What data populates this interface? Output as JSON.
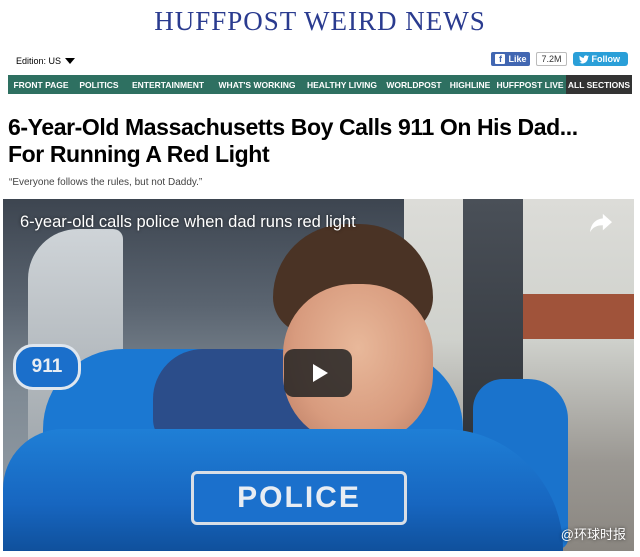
{
  "site": {
    "brand": "HUFFPOST WEIRD NEWS"
  },
  "edition": {
    "label": "Edition: US"
  },
  "social": {
    "facebook_label": "Like",
    "facebook_count": "7.2M",
    "twitter_label": "Follow"
  },
  "nav": {
    "items": [
      {
        "label": "FRONT PAGE"
      },
      {
        "label": "POLITICS"
      },
      {
        "label": "ENTERTAINMENT"
      },
      {
        "label": "WHAT'S WORKING"
      },
      {
        "label": "HEALTHY LIVING"
      },
      {
        "label": "WORLDPOST"
      },
      {
        "label": "HIGHLINE"
      },
      {
        "label": "HUFFPOST LIVE"
      },
      {
        "label": "ALL SECTIONS"
      }
    ]
  },
  "article": {
    "headline_line1": "6-Year-Old Massachusetts Boy Calls 911 On His Dad...",
    "headline_line2": "For Running A Red Light",
    "subhead": "“Everyone follows the rules, but not Daddy.”"
  },
  "video": {
    "title": "6-year-old calls police when dad runs red light",
    "badge_text": "911",
    "plate_text": "POLICE",
    "watermark": "@环球时报"
  },
  "colors": {
    "brand": "#2a3b8f",
    "nav_bg": "#2e7061",
    "nav_last_bg": "#333333",
    "facebook": "#4267b2",
    "twitter": "#2a9fd8"
  }
}
